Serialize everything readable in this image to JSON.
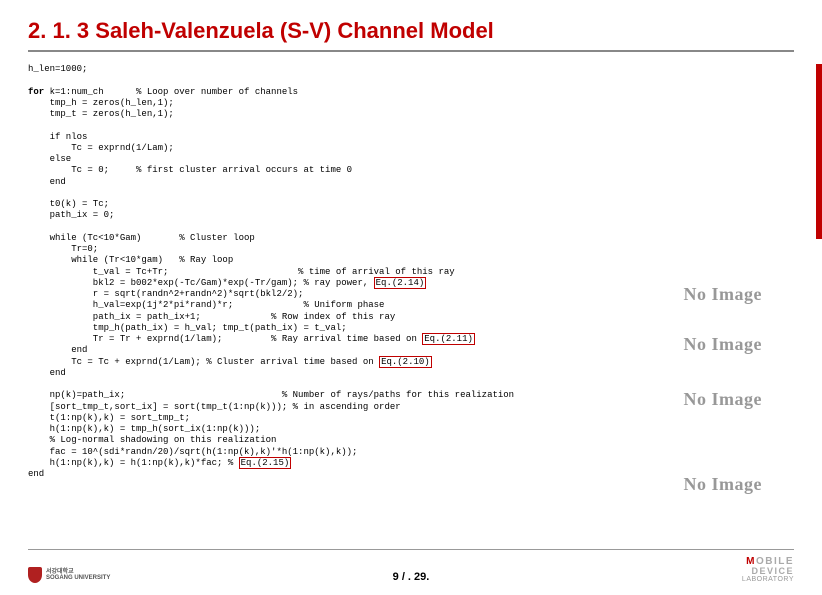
{
  "title": "2. 1. 3 Saleh-Valenzuela (S-V) Channel Model",
  "code": {
    "l01": "h_len=1000;",
    "l02": "for k=1:num_ch      % Loop over number of channels",
    "l03": "    tmp_h = zeros(h_len,1);",
    "l04": "    tmp_t = zeros(h_len,1);",
    "l05": "    if nlos",
    "l06": "        Tc = exprnd(1/Lam);",
    "l07": "    else",
    "l08": "        Tc = 0;     % first cluster arrival occurs at time 0",
    "l09": "    end",
    "l10": "    t0(k) = Tc;",
    "l11": "    path_ix = 0;",
    "l12": "    while (Tc<10*Gam)       % Cluster loop",
    "l13": "        Tr=0;",
    "l14": "        while (Tr<10*gam)   % Ray loop",
    "l15": "            t_val = Tc+Tr;                        % time of arrival of this ray",
    "l16a": "            bkl2 = b002*exp(-Tc/Gam)*exp(-Tr/gam); % ray power, ",
    "l16b": "Eq.(2.14)",
    "l17": "            r = sqrt(randn^2+randn^2)*sqrt(bkl2/2);",
    "l18": "            h_val=exp(1j*2*pi*rand)*r;             % Uniform phase",
    "l19": "            path_ix = path_ix+1;             % Row index of this ray",
    "l20": "            tmp_h(path_ix) = h_val; tmp_t(path_ix) = t_val;",
    "l21a": "            Tr = Tr + exprnd(1/lam);         % Ray arrival time based on ",
    "l21b": "Eq.(2.11)",
    "l22": "        end",
    "l23a": "        Tc = Tc + exprnd(1/Lam); % Cluster arrival time based on ",
    "l23b": "Eq.(2.10)",
    "l24": "    end",
    "l25": "    np(k)=path_ix;                             % Number of rays/paths for this realization",
    "l26": "    [sort_tmp_t,sort_ix] = sort(tmp_t(1:np(k))); % in ascending order",
    "l27": "    t(1:np(k),k) = sort_tmp_t;",
    "l28": "    h(1:np(k),k) = tmp_h(sort_ix(1:np(k)));",
    "l29": "    % Log-normal shadowing on this realization",
    "l30": "    fac = 10^(sdi*randn/20)/sqrt(h(1:np(k),k)'*h(1:np(k),k));",
    "l31a": "    h(1:np(k),k) = h(1:np(k),k)*fac; % ",
    "l31b": "Eq.(2.15)",
    "l32": "end"
  },
  "placeholders": {
    "text": "No\nImage"
  },
  "footer": {
    "university_line1": "서강대학교",
    "university_line2": "SOGANG UNIVERSITY",
    "page": "9 / . 29.",
    "mobile": "MOBILE",
    "device": "DEVICE",
    "lab": "LABORATORY"
  }
}
